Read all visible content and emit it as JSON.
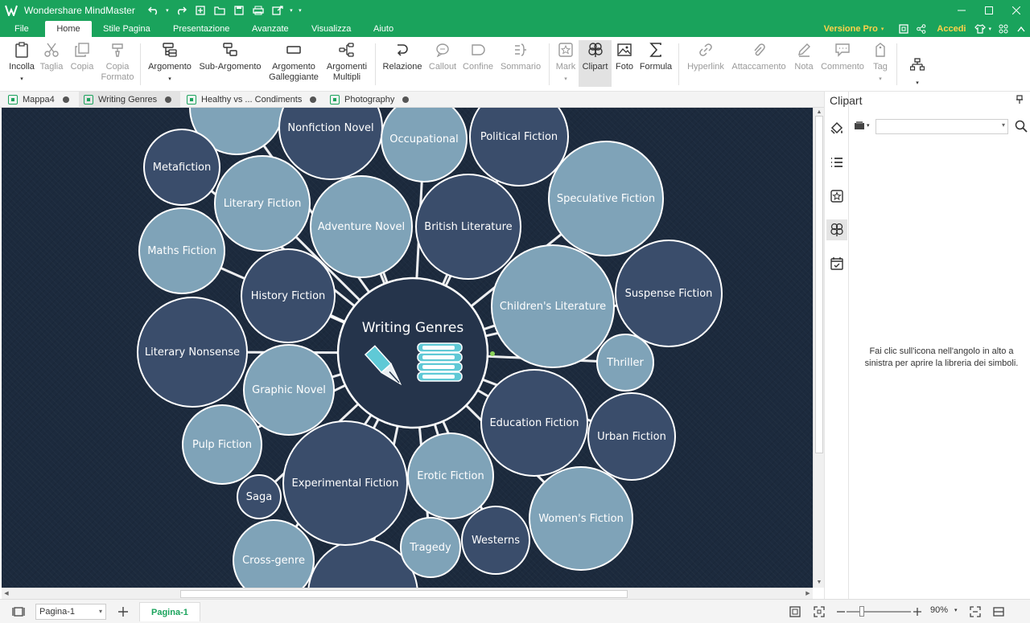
{
  "app": {
    "title": "Wondershare MindMaster"
  },
  "menu": {
    "tabs": [
      "File",
      "Home",
      "Stile Pagina",
      "Presentazione",
      "Avanzate",
      "Visualizza",
      "Aiuto"
    ],
    "active": "Home",
    "pro_label": "Versione Pro",
    "login_label": "Accedi"
  },
  "ribbon": {
    "incolla": "Incolla",
    "taglia": "Taglia",
    "copia": "Copia",
    "copia_formato": [
      "Copia",
      "Formato"
    ],
    "argomento": "Argomento",
    "sub_argomento": "Sub-Argomento",
    "argomento_galleggiante": [
      "Argomento",
      "Galleggiante"
    ],
    "argomenti_multipli": [
      "Argomenti",
      "Multipli"
    ],
    "relazione": "Relazione",
    "callout": "Callout",
    "confine": "Confine",
    "sommario": "Sommario",
    "mark": "Mark",
    "clipart": "Clipart",
    "foto": "Foto",
    "formula": "Formula",
    "hyperlink": "Hyperlink",
    "attaccamento": "Attaccamento",
    "nota": "Nota",
    "commento": "Commento",
    "tag": "Tag"
  },
  "doc_tabs": [
    "Mappa4",
    "Writing Genres",
    "Healthy vs ... Condiments",
    "Photography"
  ],
  "mindmap": {
    "central": "Writing Genres",
    "topics": [
      "Nonfiction Novel",
      "Occupational",
      "Political Fiction",
      "Metafiction",
      "Literary Fiction",
      "Adventure Novel",
      "British Literature",
      "Speculative Fiction",
      "Maths Fiction",
      "History Fiction",
      "Children's Literature",
      "Suspense Fiction",
      "Literary Nonsense",
      "Thriller",
      "Graphic Novel",
      "Education Fiction",
      "Urban Fiction",
      "Pulp Fiction",
      "Experimental Fiction",
      "Erotic Fiction",
      "Saga",
      "Women's Fiction",
      "Westerns",
      "Tragedy",
      "Cross-genre"
    ],
    "colors": {
      "light": "#7fa3b8",
      "dark": "#3a4d6b",
      "center": "#25344b",
      "accent": "#5fc9d6"
    }
  },
  "panel": {
    "title": "Clipart",
    "hint": "Fai clic sull'icona nell'angolo in alto a sinistra per aprire la libreria dei simboli."
  },
  "status": {
    "page_select": "Pagina-1",
    "page_tab": "Pagina-1",
    "zoom": "90%"
  }
}
